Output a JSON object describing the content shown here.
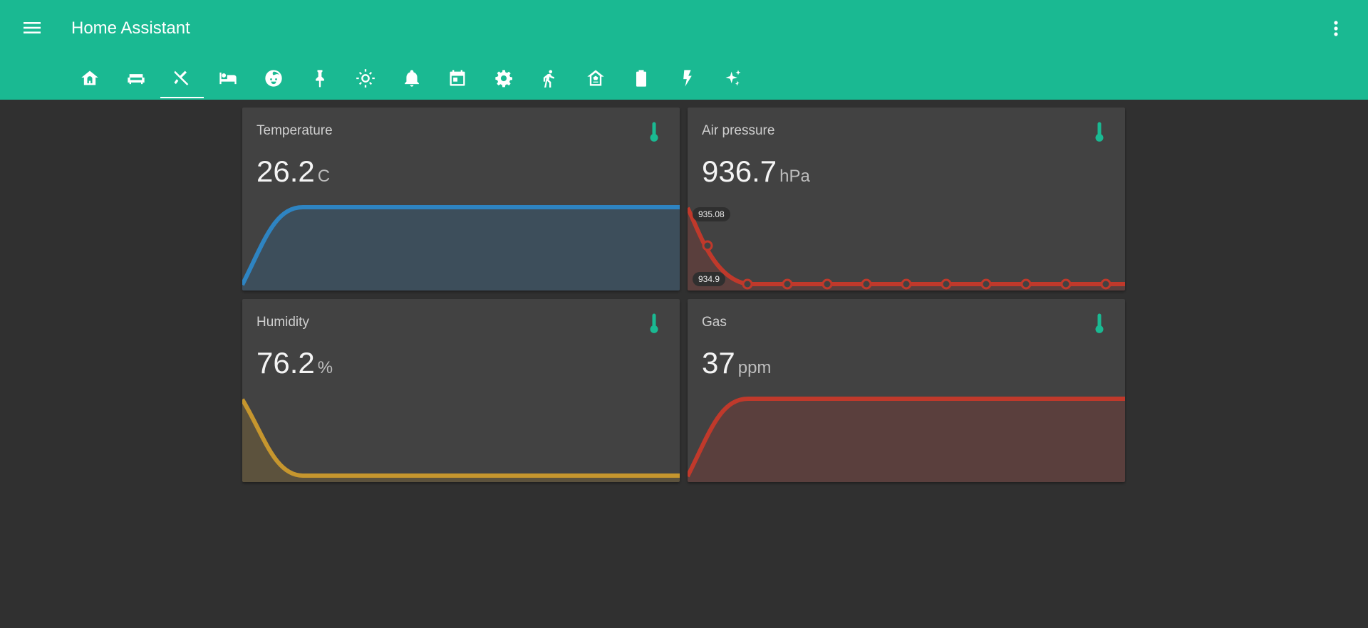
{
  "header": {
    "title": "Home Assistant",
    "menu_icon": "menu-icon",
    "more_icon": "more-vertical-icon"
  },
  "tabs": [
    {
      "icon": "home-icon",
      "active": false
    },
    {
      "icon": "sofa-icon",
      "active": false
    },
    {
      "icon": "silverware-icon",
      "active": true
    },
    {
      "icon": "bed-icon",
      "active": false
    },
    {
      "icon": "baby-face-icon",
      "active": false
    },
    {
      "icon": "pin-icon",
      "active": false
    },
    {
      "icon": "brightness-icon",
      "active": false
    },
    {
      "icon": "bell-icon",
      "active": false
    },
    {
      "icon": "calendar-icon",
      "active": false
    },
    {
      "icon": "settings-icon",
      "active": false
    },
    {
      "icon": "walk-icon",
      "active": false
    },
    {
      "icon": "home-automation-icon",
      "active": false
    },
    {
      "icon": "battery-icon",
      "active": false
    },
    {
      "icon": "flash-icon",
      "active": false
    },
    {
      "icon": "sparkles-icon",
      "active": false
    }
  ],
  "colors": {
    "header": "#1ab992",
    "background": "#303030",
    "card": "#424242",
    "icon_accent": "#1ab992",
    "temperature_line": "#2e84c2",
    "pressure_line": "#c0392b",
    "humidity_line": "#c6962e",
    "gas_line": "#c0392b"
  },
  "cards": {
    "temperature": {
      "name": "Temperature",
      "value": "26.2",
      "unit": "C",
      "icon": "thermometer-icon"
    },
    "pressure": {
      "name": "Air pressure",
      "value": "936.7",
      "unit": "hPa",
      "icon": "thermometer-icon",
      "labels": {
        "max": "935.08",
        "min": "934.9"
      }
    },
    "humidity": {
      "name": "Humidity",
      "value": "76.2",
      "unit": "%",
      "icon": "thermometer-icon"
    },
    "gas": {
      "name": "Gas",
      "value": "37",
      "unit": "ppm",
      "icon": "thermometer-icon"
    }
  }
}
